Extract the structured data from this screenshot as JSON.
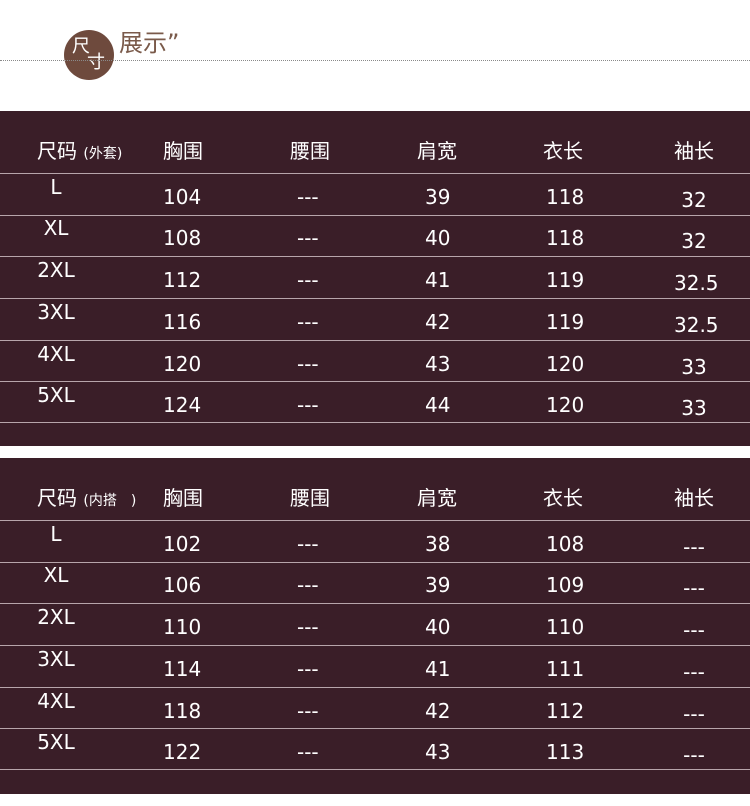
{
  "header": {
    "badge_char1": "尺",
    "badge_char2": "寸",
    "title": "展示”"
  },
  "tables": [
    {
      "size_label": "尺码",
      "size_sub": "(外套)",
      "columns": [
        "胸围",
        "腰围",
        "肩宽",
        "衣长",
        "袖长"
      ],
      "rows": [
        [
          "L",
          "104",
          "---",
          "39",
          "118",
          "32"
        ],
        [
          "XL",
          "108",
          "---",
          "40",
          "118",
          "32"
        ],
        [
          "2XL",
          "112",
          "---",
          "41",
          "119",
          "32.5"
        ],
        [
          "3XL",
          "116",
          "---",
          "42",
          "119",
          "32.5"
        ],
        [
          "4XL",
          "120",
          "---",
          "43",
          "120",
          "33"
        ],
        [
          "5XL",
          "124",
          "---",
          "44",
          "120",
          "33"
        ]
      ]
    },
    {
      "size_label": "尺码",
      "size_sub": "(内搭　)",
      "columns": [
        "胸围",
        "腰围",
        "肩宽",
        "衣长",
        "袖长"
      ],
      "rows": [
        [
          "L",
          "102",
          "---",
          "38",
          "108",
          "---"
        ],
        [
          "XL",
          "106",
          "---",
          "39",
          "109",
          "---"
        ],
        [
          "2XL",
          "110",
          "---",
          "40",
          "110",
          "---"
        ],
        [
          "3XL",
          "114",
          "---",
          "41",
          "111",
          "---"
        ],
        [
          "4XL",
          "118",
          "---",
          "42",
          "112",
          "---"
        ],
        [
          "5XL",
          "122",
          "---",
          "43",
          "113",
          "---"
        ]
      ]
    }
  ],
  "colors": {
    "table_bg": "#3a1e28",
    "badge_bg": "#6e4a3d",
    "title_color": "#7a5a4a"
  }
}
